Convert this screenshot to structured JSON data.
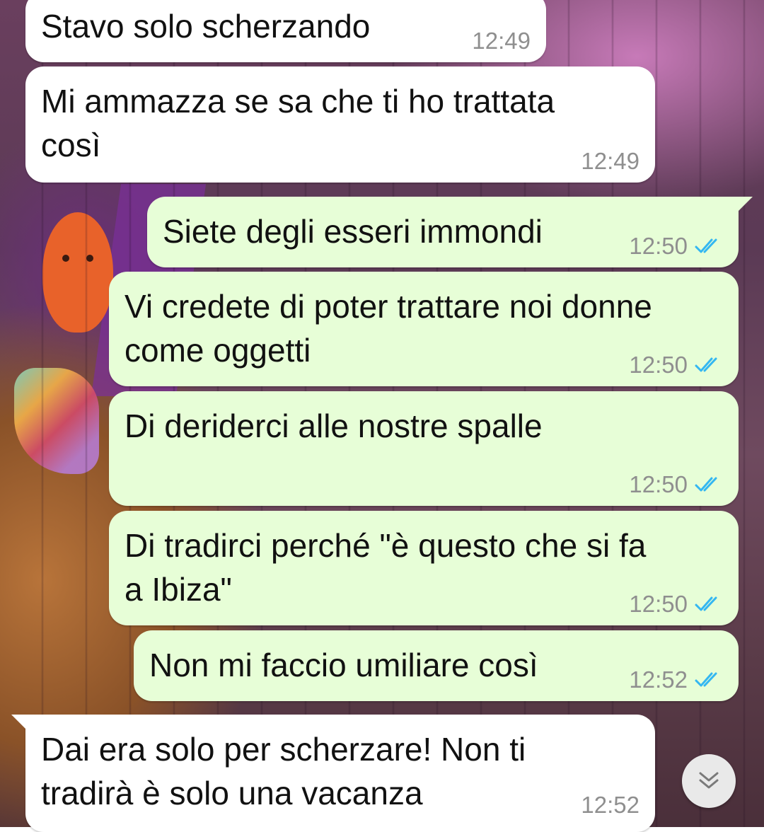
{
  "chat": {
    "messages": [
      {
        "direction": "incoming",
        "text": "Stavo solo scherzando",
        "time": "12:49"
      },
      {
        "direction": "incoming",
        "text": "Mi ammazza se sa che ti ho trattata\ncosì",
        "time": "12:49"
      },
      {
        "direction": "outgoing",
        "text": "Siete degli esseri immondi",
        "time": "12:50",
        "status_icon": "double-check-read-icon"
      },
      {
        "direction": "outgoing",
        "text": "Vi credete di poter trattare noi donne\ncome oggetti",
        "time": "12:50",
        "status_icon": "double-check-read-icon"
      },
      {
        "direction": "outgoing",
        "text": "Di deriderci alle nostre spalle",
        "time": "12:50",
        "status_icon": "double-check-read-icon"
      },
      {
        "direction": "outgoing",
        "text": "Di tradirci perché \"è questo che si fa\na Ibiza\"",
        "time": "12:50",
        "status_icon": "double-check-read-icon"
      },
      {
        "direction": "outgoing",
        "text": "Non mi faccio umiliare così",
        "time": "12:52",
        "status_icon": "double-check-read-icon"
      },
      {
        "direction": "incoming",
        "text": "Dai era solo per scherzare! Non ti\ntradirà è solo una vacanza",
        "time": "12:52"
      }
    ]
  },
  "scroll_to_bottom": {
    "icon": "chevron-double-down-icon"
  },
  "colors": {
    "incoming_bubble": "#ffffff",
    "outgoing_bubble": "#e7fed7",
    "read_tick": "#34b7f1",
    "timestamp": "#8f8f8f"
  }
}
